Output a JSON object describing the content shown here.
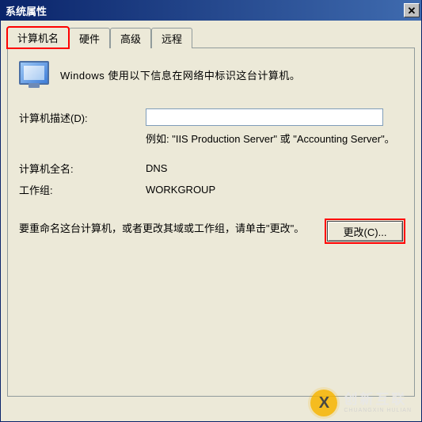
{
  "window": {
    "title": "系统属性",
    "close_glyph": "✕"
  },
  "tabs": [
    {
      "label": "计算机名",
      "active": true,
      "highlight": true
    },
    {
      "label": "硬件",
      "active": false,
      "highlight": false
    },
    {
      "label": "高级",
      "active": false,
      "highlight": false
    },
    {
      "label": "远程",
      "active": false,
      "highlight": false
    }
  ],
  "intro_text": "Windows 使用以下信息在网络中标识这台计算机。",
  "description": {
    "label": "计算机描述(D):",
    "value": "",
    "placeholder": "",
    "example": "例如: \"IIS Production Server\" 或 \"Accounting Server\"。"
  },
  "full_name": {
    "label": "计算机全名:",
    "value": "DNS"
  },
  "workgroup": {
    "label": "工作组:",
    "value": "WORKGROUP"
  },
  "change": {
    "text": "要重命名这台计算机，或者更改其域或工作组，请单击\"更改\"。",
    "button_label": "更改(C)...",
    "highlight": true
  },
  "watermark": {
    "brand_cn": "创新互联",
    "brand_en": "CHUANGXIN HULIAN",
    "glyph": "X"
  }
}
